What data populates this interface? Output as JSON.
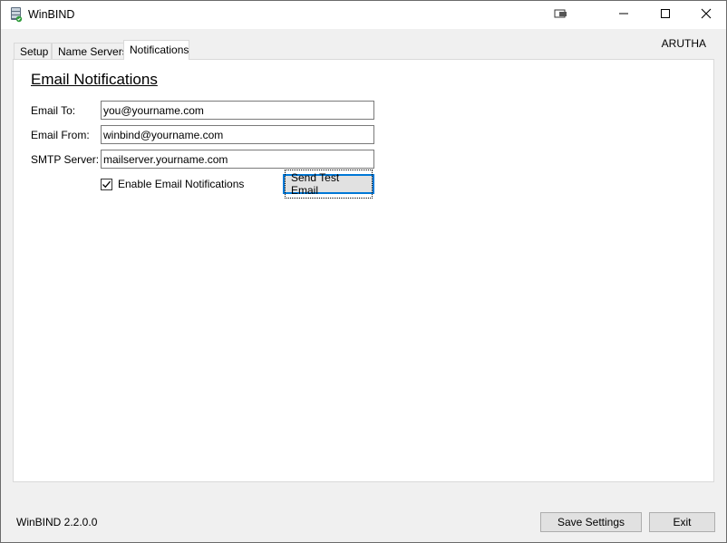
{
  "window": {
    "title": "WinBIND",
    "icon": "database-server-icon"
  },
  "titlebar_buttons": [
    "restore-window-icon",
    "minimize-icon",
    "maximize-icon",
    "close-icon"
  ],
  "tabs": [
    {
      "label": "Setup",
      "active": false
    },
    {
      "label": "Name Servers",
      "active": false
    },
    {
      "label": "Notifications",
      "active": true
    }
  ],
  "machine_name": "ARUTHA",
  "notifications": {
    "section_title": "Email Notifications",
    "email_to": {
      "label": "Email To:",
      "value": "you@yourname.com"
    },
    "email_from": {
      "label": "Email From:",
      "value": "winbind@yourname.com"
    },
    "smtp_server": {
      "label": "SMTP Server:",
      "value": "mailserver.yourname.com"
    },
    "enable_checkbox": {
      "label": "Enable Email Notifications",
      "checked": true
    },
    "send_test_label": "Send Test Email"
  },
  "footer": {
    "version": "WinBIND 2.2.0.0",
    "save_label": "Save Settings",
    "exit_label": "Exit"
  },
  "colors": {
    "focus_accent": "#0078d7",
    "window_bg": "#f0f0f0",
    "panel_bg": "#ffffff"
  }
}
